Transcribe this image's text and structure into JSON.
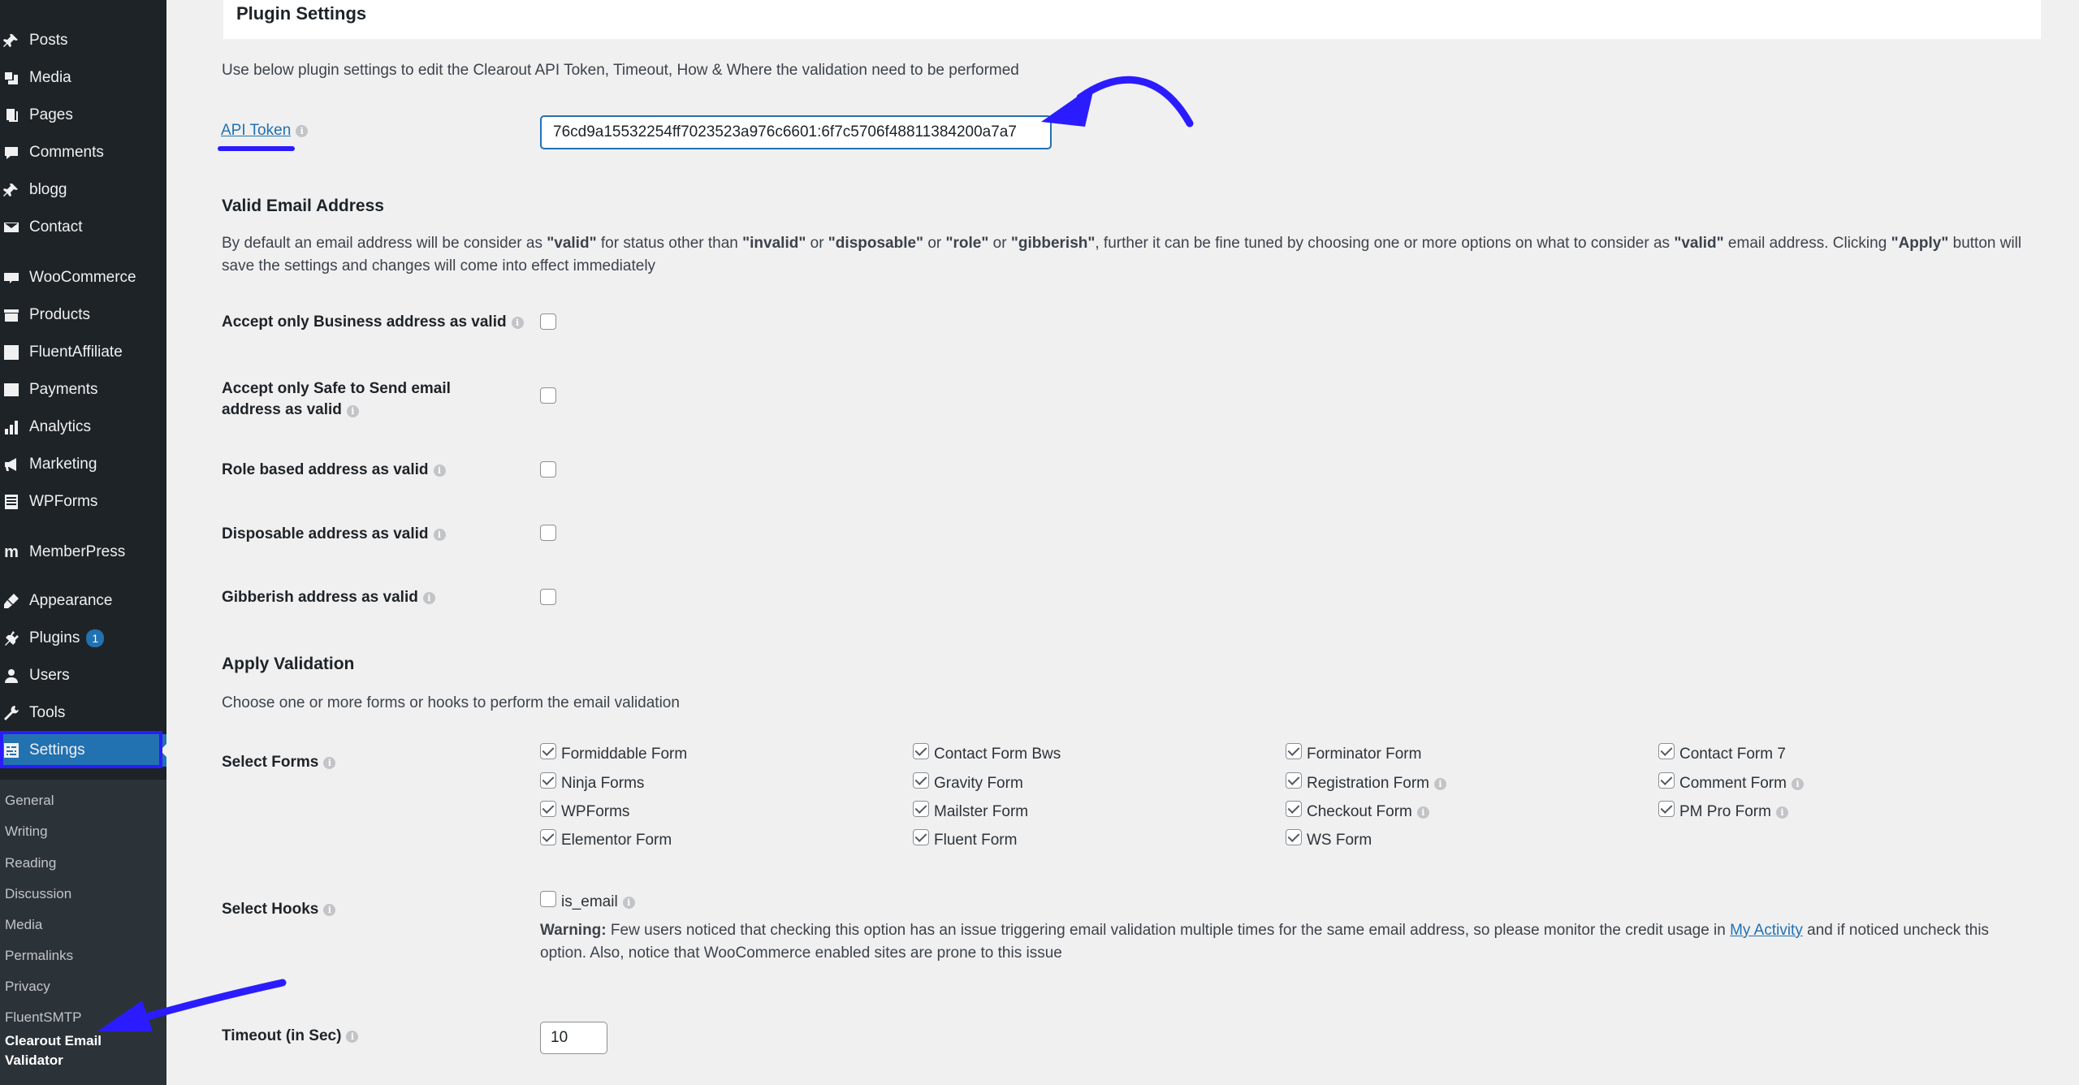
{
  "sidebar": {
    "items": [
      {
        "label": "Posts",
        "icon": "pin-icon"
      },
      {
        "label": "Media",
        "icon": "media-icon"
      },
      {
        "label": "Pages",
        "icon": "pages-icon"
      },
      {
        "label": "Comments",
        "icon": "comments-icon"
      },
      {
        "label": "blogg",
        "icon": "pin-icon"
      },
      {
        "label": "Contact",
        "icon": "mail-icon"
      },
      {
        "label": "WooCommerce",
        "icon": "woo-icon"
      },
      {
        "label": "Products",
        "icon": "archive-icon"
      },
      {
        "label": "FluentAffiliate",
        "icon": "percent-icon"
      },
      {
        "label": "Payments",
        "icon": "dollar-icon"
      },
      {
        "label": "Analytics",
        "icon": "bar-chart-icon"
      },
      {
        "label": "Marketing",
        "icon": "megaphone-icon"
      },
      {
        "label": "WPForms",
        "icon": "form-icon"
      },
      {
        "label": "MemberPress",
        "icon": "memberpress-icon"
      },
      {
        "label": "Appearance",
        "icon": "brush-icon"
      },
      {
        "label": "Plugins",
        "icon": "plugin-icon",
        "badge": "1"
      },
      {
        "label": "Users",
        "icon": "user-icon"
      },
      {
        "label": "Tools",
        "icon": "wrench-icon"
      },
      {
        "label": "Settings",
        "icon": "settings-icon",
        "active": true
      }
    ],
    "submenu": [
      "General",
      "Writing",
      "Reading",
      "Discussion",
      "Media",
      "Permalinks",
      "Privacy",
      "FluentSMTP",
      "Clearout Email Validator"
    ]
  },
  "page": {
    "title": "Plugin Settings",
    "intro": "Use below plugin settings to edit the Clearout API Token, Timeout, How & Where the validation need to be performed",
    "api_token_label": "API Token",
    "api_token_value": "76cd9a15532254ff7023523a976c6601:6f7c5706f48811384200a7a7"
  },
  "valid_email": {
    "title": "Valid Email Address",
    "desc_parts": [
      "By default an email address will be consider as ",
      "\"valid\"",
      " for status other than ",
      "\"invalid\"",
      " or ",
      "\"disposable\"",
      " or ",
      "\"role\"",
      " or ",
      "\"gibberish\"",
      ", further it can be fine tuned by choosing one or more options on what to consider as ",
      "\"valid\"",
      " email address. Clicking ",
      "\"Apply\"",
      " button will save the settings and changes will come into effect immediately"
    ],
    "options": [
      "Accept only Business address as valid",
      "Accept only Safe to Send email address as valid",
      "Role based address as valid",
      "Disposable address as valid",
      "Gibberish address as valid"
    ]
  },
  "apply_validation": {
    "title": "Apply Validation",
    "desc": "Choose one or more forms or hooks to perform the email validation",
    "select_forms_label": "Select Forms",
    "forms": [
      [
        "Formiddable Form",
        "Ninja Forms",
        "WPForms",
        "Elementor Form"
      ],
      [
        "Contact Form Bws",
        "Gravity Form",
        "Mailster Form",
        "Fluent Form"
      ],
      [
        "Forminator Form",
        "Registration Form",
        "Checkout Form",
        "WS Form"
      ],
      [
        "Contact Form 7",
        "Comment Form",
        "PM Pro Form"
      ]
    ],
    "select_hooks_label": "Select Hooks",
    "hook": "is_email",
    "warning_label": "Warning:",
    "warning_text": " Few users noticed that checking this option has an issue triggering email validation multiple times for the same email address, so please monitor the credit usage in ",
    "warning_link": "My Activity",
    "warning_tail": " and if noticed uncheck this option. Also, notice that WooCommerce enabled sites are prone to this issue",
    "timeout_label": "Timeout (in Sec)",
    "timeout_value": "10"
  },
  "colors": {
    "sidebar_bg": "#1d2327",
    "accent": "#2271b1",
    "annotation": "#2b1cff"
  }
}
